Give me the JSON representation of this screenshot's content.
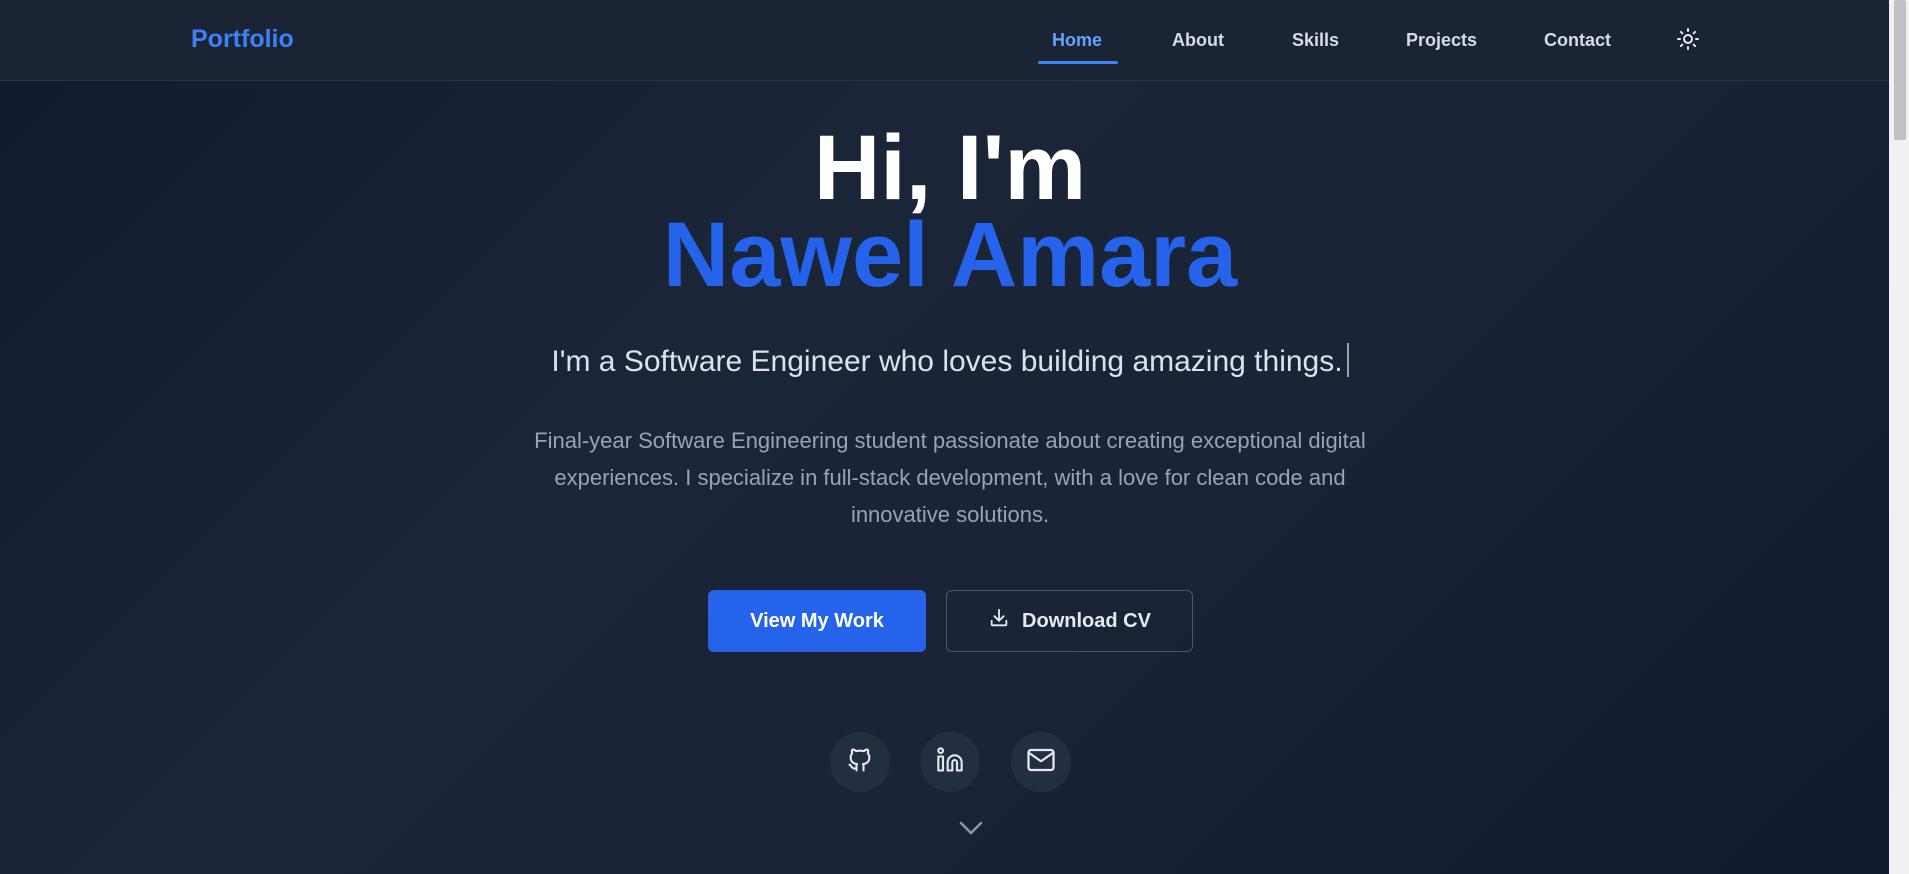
{
  "header": {
    "brand": "Portfolio",
    "nav": [
      {
        "label": "Home",
        "active": true
      },
      {
        "label": "About"
      },
      {
        "label": "Skills"
      },
      {
        "label": "Projects"
      },
      {
        "label": "Contact"
      }
    ],
    "theme_icon": "sun-icon"
  },
  "hero": {
    "greeting": "Hi, I'm",
    "name": "Nawel Amara",
    "tagline": "I'm a Software Engineer who loves building amazing things.",
    "description": "Final-year Software Engineering student passionate about creating exceptional digital experiences. I specialize in full-stack development, with a love for clean code and innovative solutions.",
    "primary_button": "View My Work",
    "secondary_button": "Download CV",
    "secondary_button_icon": "download-icon"
  },
  "social": [
    {
      "icon": "github-icon"
    },
    {
      "icon": "linkedin-icon"
    },
    {
      "icon": "mail-icon"
    }
  ],
  "scroll_icon": "chevron-down-icon",
  "colors": {
    "accent": "#2563eb",
    "accent_light": "#60a5fa",
    "background": "#1a2436",
    "text_primary": "#ffffff",
    "text_muted": "#97a3b6"
  }
}
